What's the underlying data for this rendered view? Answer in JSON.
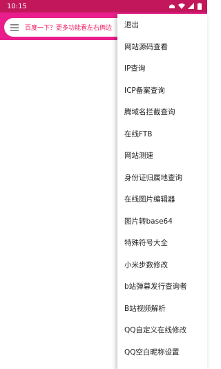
{
  "status_bar": {
    "time": "10:15",
    "icons": [
      "android-icon",
      "wifi-icon",
      "signal-icon",
      "battery-icon"
    ]
  },
  "search": {
    "placeholder_text": "百度一下？更多功能看左右俩边"
  },
  "menu": {
    "items": [
      "退出",
      "网站源码查看",
      "IP查询",
      "ICP备案查询",
      "腾域名拦截查询",
      "在线FTB",
      "网站测速",
      "身份证归属地查询",
      "在线图片编辑器",
      "图片转base64",
      "特殊符号大全",
      "小米步数修改",
      "b站弹幕发行查询者",
      "B站视频解析",
      "QQ自定义在线修改",
      "QQ空白昵称设置"
    ]
  },
  "colors": {
    "status_bar": "#c2185b",
    "app_bar": "#e91e8c",
    "accent_text": "#e91e63"
  }
}
